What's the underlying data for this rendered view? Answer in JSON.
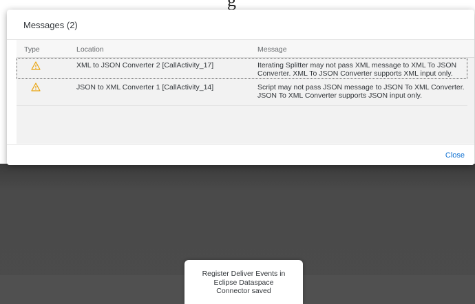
{
  "background_partial_text": "g",
  "dialog": {
    "title": "Messages (2)",
    "columns": {
      "type": "Type",
      "location": "Location",
      "message": "Message"
    },
    "rows": [
      {
        "icon": "warning-icon",
        "location": "XML to JSON Converter 2 [CallActivity_17]",
        "message_line1": "Iterating Splitter may not pass XML message to XML To JSON",
        "message_line2": "Converter. XML To JSON Converter supports XML input only."
      },
      {
        "icon": "warning-icon",
        "location": "JSON to XML Converter 1 [CallActivity_14]",
        "message_line1": "Script may not pass JSON message to JSON To XML Converter.",
        "message_line2": "JSON To XML Converter supports JSON input only."
      }
    ],
    "close_label": "Close"
  },
  "toast": {
    "line1": "Register Deliver Events in",
    "line2": "Eclipse Dataspace",
    "line3": "Connector saved"
  },
  "colors": {
    "warning": "#e9730c",
    "link": "#0a6ed1",
    "backdrop": "#4a4a4a"
  }
}
